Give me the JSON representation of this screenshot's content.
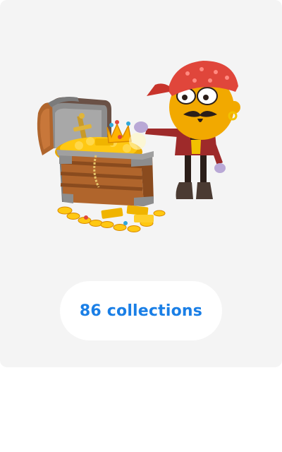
{
  "colors": {
    "card_bg": "#f4f4f4",
    "accent": "#1a7fe6",
    "pill_bg": "#ffffff"
  },
  "illustration": {
    "characters": [
      "treasure-chest-icon",
      "pirate-character-icon"
    ]
  },
  "collections_button": {
    "label": "86 collections"
  }
}
